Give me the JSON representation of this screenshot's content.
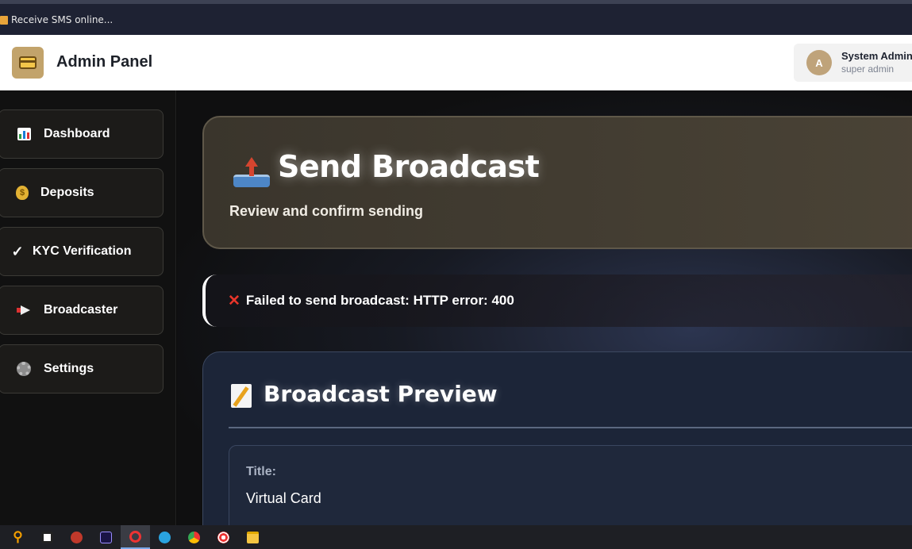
{
  "browser": {
    "tab_title": "Receive SMS online..."
  },
  "header": {
    "app_title": "Admin Panel",
    "user": {
      "avatar_initial": "A",
      "name": "System Admin",
      "role": "super admin"
    }
  },
  "sidebar": {
    "items": [
      {
        "label": "Dashboard",
        "icon": "bar-chart-icon"
      },
      {
        "label": "Deposits",
        "icon": "money-bag-icon"
      },
      {
        "label": "KYC Verification",
        "icon": "check-mark-icon"
      },
      {
        "label": "Broadcaster",
        "icon": "megaphone-icon"
      },
      {
        "label": "Settings",
        "icon": "gear-icon"
      }
    ]
  },
  "main": {
    "hero": {
      "title": "Send Broadcast",
      "subtitle": "Review and confirm sending",
      "icon": "outbox-tray-icon"
    },
    "alert": {
      "icon": "cross-mark-icon",
      "message": "Failed to send broadcast: HTTP error: 400"
    },
    "preview": {
      "title": "Broadcast Preview",
      "icon": "memo-icon",
      "field_label": "Title:",
      "field_value": "Virtual Card"
    }
  },
  "taskbar": {
    "apps": [
      "search-icon",
      "capcut-icon",
      "app-icon",
      "premiere-pro-icon",
      "opera-icon",
      "telegram-icon",
      "chrome-icon",
      "target-app-icon",
      "file-explorer-icon"
    ]
  },
  "colors": {
    "accent_gold": "#c2a36b",
    "error_red": "#e8352a",
    "sidebar_bg": "#111111",
    "header_bg": "#ffffff"
  }
}
